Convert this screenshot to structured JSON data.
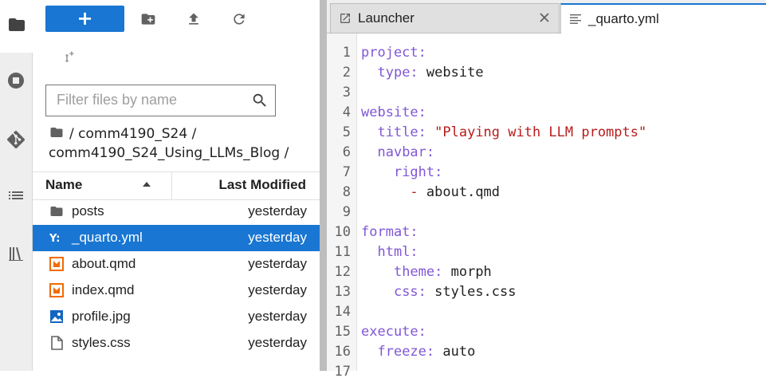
{
  "file_browser": {
    "new_label": "+",
    "filter_placeholder": "Filter files by name",
    "breadcrumb_line1": "/ comm4190_S24 /",
    "breadcrumb_line2": "comm4190_S24_Using_LLMs_Blog /",
    "col_name": "Name",
    "col_modified": "Last Modified",
    "files": [
      {
        "name": "posts",
        "modified": "yesterday",
        "icon": "folder-icon",
        "selected": false
      },
      {
        "name": "_quarto.yml",
        "modified": "yesterday",
        "icon": "yaml-icon",
        "selected": true
      },
      {
        "name": "about.qmd",
        "modified": "yesterday",
        "icon": "markdown-icon",
        "selected": false
      },
      {
        "name": "index.qmd",
        "modified": "yesterday",
        "icon": "markdown-icon",
        "selected": false
      },
      {
        "name": "profile.jpg",
        "modified": "yesterday",
        "icon": "image-icon",
        "selected": false
      },
      {
        "name": "styles.css",
        "modified": "yesterday",
        "icon": "file-icon",
        "selected": false
      }
    ]
  },
  "tabs": [
    {
      "label": "Launcher",
      "active": false
    },
    {
      "label": "_quarto.yml",
      "active": true
    }
  ],
  "editor": {
    "lines": [
      {
        "num": "1",
        "indent": "",
        "key": "project:",
        "value": "",
        "dash": ""
      },
      {
        "num": "2",
        "indent": "  ",
        "key": "type:",
        "value": " website",
        "dash": ""
      },
      {
        "num": "3",
        "indent": "",
        "key": "",
        "value": "",
        "dash": ""
      },
      {
        "num": "4",
        "indent": "",
        "key": "website:",
        "value": "",
        "dash": ""
      },
      {
        "num": "5",
        "indent": "  ",
        "key": "title:",
        "value": " \"Playing with LLM prompts\"",
        "dash": "",
        "string": true
      },
      {
        "num": "6",
        "indent": "  ",
        "key": "navbar:",
        "value": "",
        "dash": ""
      },
      {
        "num": "7",
        "indent": "    ",
        "key": "right:",
        "value": "",
        "dash": ""
      },
      {
        "num": "8",
        "indent": "      ",
        "key": "",
        "value": " about.qmd",
        "dash": "-"
      },
      {
        "num": "9",
        "indent": "",
        "key": "",
        "value": "",
        "dash": ""
      },
      {
        "num": "10",
        "indent": "",
        "key": "format:",
        "value": "",
        "dash": ""
      },
      {
        "num": "11",
        "indent": "  ",
        "key": "html:",
        "value": "",
        "dash": ""
      },
      {
        "num": "12",
        "indent": "    ",
        "key": "theme:",
        "value": " morph",
        "dash": ""
      },
      {
        "num": "13",
        "indent": "    ",
        "key": "css:",
        "value": " styles.css",
        "dash": ""
      },
      {
        "num": "14",
        "indent": "",
        "key": "",
        "value": "",
        "dash": ""
      },
      {
        "num": "15",
        "indent": "",
        "key": "execute:",
        "value": "",
        "dash": ""
      },
      {
        "num": "16",
        "indent": "  ",
        "key": "freeze:",
        "value": " auto",
        "dash": ""
      },
      {
        "num": "17",
        "indent": "",
        "key": "",
        "value": "",
        "dash": ""
      }
    ]
  },
  "colors": {
    "accent": "#1976d2",
    "yaml_key": "#8157d6",
    "yaml_string": "#b71c1c"
  }
}
